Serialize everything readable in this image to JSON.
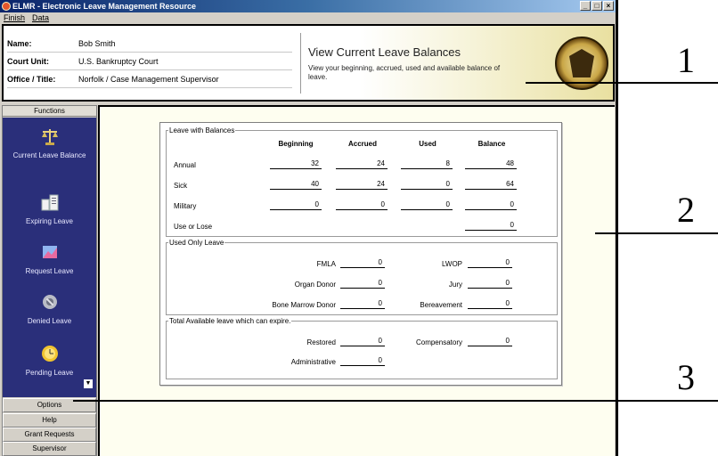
{
  "window": {
    "title": "ELMR - Electronic Leave Management Resource",
    "buttons": [
      "_",
      "□",
      "×"
    ]
  },
  "menu": {
    "items": [
      "Finish",
      "Data"
    ]
  },
  "header": {
    "fields": [
      {
        "label": "Name:",
        "value": "Bob Smith"
      },
      {
        "label": "Court Unit:",
        "value": "U.S. Bankruptcy Court"
      },
      {
        "label": "Office / Title:",
        "value": "Norfolk / Case Management Supervisor"
      }
    ],
    "page_title": "View Current Leave Balances",
    "page_desc": "View your beginning, accrued, used and available balance of leave.",
    "seal_icon": "court-seal-icon"
  },
  "sidebar": {
    "functions_label": "Functions",
    "nav_items": [
      {
        "label": "Current Leave Balance",
        "icon": "scales-icon"
      },
      {
        "label": "Expiring Leave",
        "icon": "document-icon"
      },
      {
        "label": "Request Leave",
        "icon": "request-icon"
      },
      {
        "label": "Denied Leave",
        "icon": "denied-icon"
      },
      {
        "label": "Pending Leave",
        "icon": "clock-icon"
      }
    ],
    "bottom_buttons": [
      "Options",
      "Help",
      "Grant Requests",
      "Supervisor"
    ]
  },
  "balances": {
    "legend": "Leave with Balances",
    "headers": [
      "Beginning",
      "Accrued",
      "Used",
      "Balance"
    ],
    "rows": [
      {
        "label": "Annual",
        "beginning": "32",
        "accrued": "24",
        "used": "8",
        "balance": "48"
      },
      {
        "label": "Sick",
        "beginning": "40",
        "accrued": "24",
        "used": "0",
        "balance": "64"
      },
      {
        "label": "Military",
        "beginning": "0",
        "accrued": "0",
        "used": "0",
        "balance": "0"
      },
      {
        "label": "Use or Lose",
        "beginning": "",
        "accrued": "",
        "used": "",
        "balance": "0"
      }
    ]
  },
  "used_only": {
    "legend": "Used Only Leave",
    "left": [
      {
        "label": "FMLA",
        "value": "0"
      },
      {
        "label": "Organ Donor",
        "value": "0"
      },
      {
        "label": "Bone Marrow Donor",
        "value": "0"
      }
    ],
    "right": [
      {
        "label": "LWOP",
        "value": "0"
      },
      {
        "label": "Jury",
        "value": "0"
      },
      {
        "label": "Bereavement",
        "value": "0"
      }
    ]
  },
  "expire": {
    "legend": "Total Available leave which can expire.",
    "left": [
      {
        "label": "Restored",
        "value": "0"
      },
      {
        "label": "Administrative",
        "value": "0"
      }
    ],
    "right": [
      {
        "label": "Compensatory",
        "value": "0"
      }
    ]
  },
  "callouts": [
    "1",
    "2",
    "3"
  ]
}
